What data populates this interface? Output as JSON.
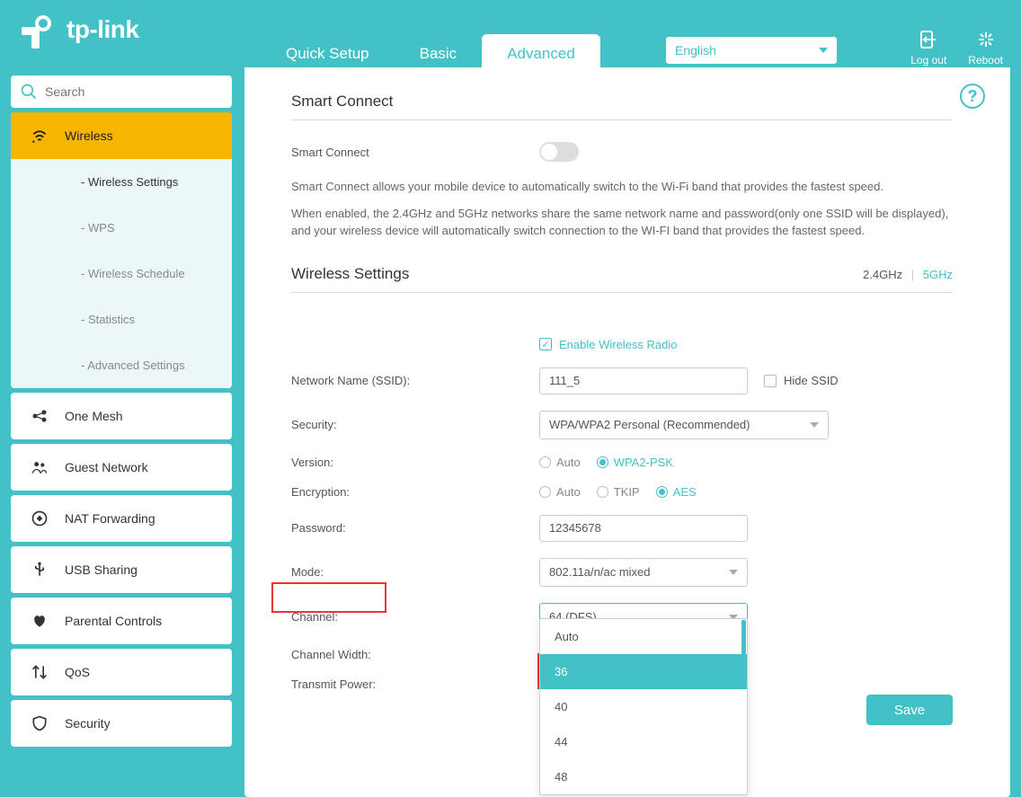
{
  "brand": "tp-link",
  "tabs": {
    "quick": "Quick Setup",
    "basic": "Basic",
    "advanced": "Advanced"
  },
  "language": "English",
  "header": {
    "logout": "Log out",
    "reboot": "Reboot"
  },
  "search": {
    "placeholder": "Search"
  },
  "nav": {
    "wireless": "Wireless",
    "wireless_sub": {
      "settings": "- Wireless Settings",
      "wps": "- WPS",
      "schedule": "- Wireless Schedule",
      "stats": "- Statistics",
      "advanced": "- Advanced Settings"
    },
    "onemesh": "One Mesh",
    "guest": "Guest Network",
    "nat": "NAT Forwarding",
    "usb": "USB Sharing",
    "parental": "Parental Controls",
    "qos": "QoS",
    "security": "Security"
  },
  "smart_connect": {
    "title": "Smart Connect",
    "label": "Smart Connect",
    "desc1": "Smart Connect allows your mobile device to automatically switch to the Wi-Fi band that provides the fastest speed.",
    "desc2": "When enabled, the 2.4GHz and 5GHz networks share the same network name and password(only one SSID will be displayed), and your wireless device will automatically switch connection to the WI-FI band that provides the fastest speed."
  },
  "wireless_settings": {
    "title": "Wireless Settings",
    "band24": "2.4GHz",
    "band5": "5GHz",
    "enable_radio": "Enable Wireless Radio",
    "ssid_label": "Network Name (SSID):",
    "ssid_value": "111_5",
    "hide_ssid": "Hide SSID",
    "security_label": "Security:",
    "security_value": "WPA/WPA2 Personal (Recommended)",
    "version_label": "Version:",
    "version_auto": "Auto",
    "version_wpa2": "WPA2-PSK",
    "encryption_label": "Encryption:",
    "enc_auto": "Auto",
    "enc_tkip": "TKIP",
    "enc_aes": "AES",
    "password_label": "Password:",
    "password_value": "12345678",
    "mode_label": "Mode:",
    "mode_value": "802.11a/n/ac mixed",
    "channel_label": "Channel:",
    "channel_value": "64 (DFS)",
    "channel_options": [
      "Auto",
      "36",
      "40",
      "44",
      "48"
    ],
    "width_label": "Channel Width:",
    "power_label": "Transmit Power:"
  },
  "save": "Save"
}
